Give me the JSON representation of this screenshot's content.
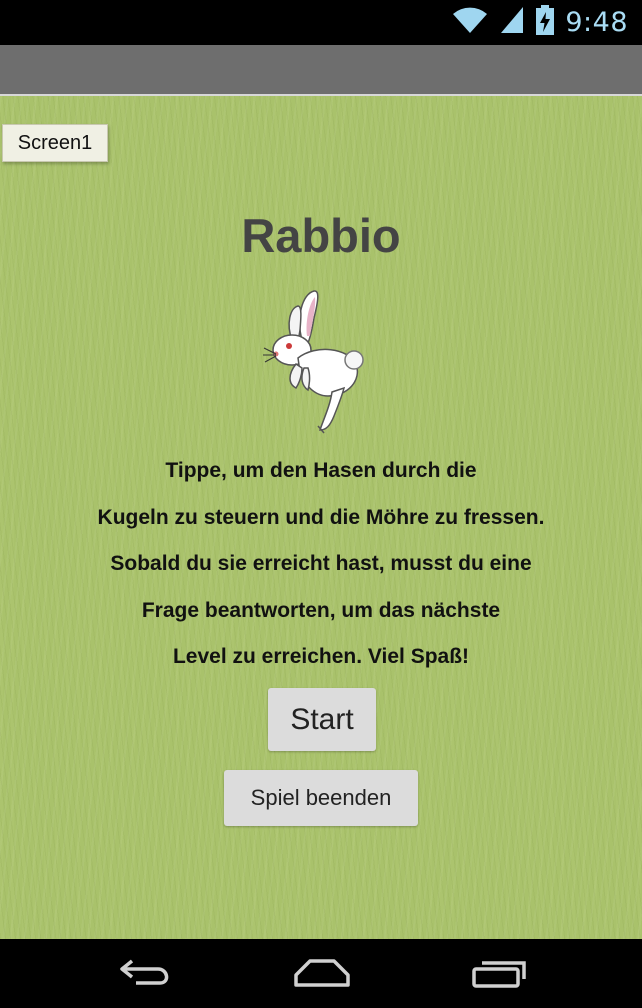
{
  "status_bar": {
    "time": "9:48",
    "icons": [
      "wifi-icon",
      "cell-signal-icon",
      "battery-charging-icon"
    ]
  },
  "screen_tab": "Screen1",
  "title": "Rabbio",
  "rabbit_image": "rabbit-icon",
  "instructions": [
    "Tippe, um den Hasen durch die",
    "Kugeln zu steuern und die Möhre zu fressen.",
    "Sobald du sie erreicht hast, musst du eine",
    "Frage beantworten, um das nächste",
    "Level zu erreichen. Viel Spaß!"
  ],
  "buttons": {
    "start": "Start",
    "quit": "Spiel beenden"
  },
  "nav_bar": [
    "back-icon",
    "home-icon",
    "recent-apps-icon"
  ],
  "colors": {
    "background": "#a9c26b",
    "title": "#444444",
    "button": "#dcdcdc",
    "status_icons": "#9fd6f0"
  }
}
